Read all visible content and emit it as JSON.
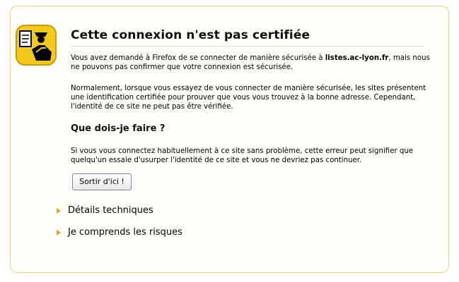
{
  "title": "Cette connexion n'est pas certifiée",
  "para1_prefix": "Vous avez demandé à Firefox de se connecter de manière sécurisée à ",
  "para1_host": "listes.ac-lyon.fr",
  "para1_suffix": ", mais nous ne pouvons pas confirmer que votre connexion est sécurisée.",
  "para2": "Normalement, lorsque vous essayez de vous connecter de manière sécurisée, les sites présentent une identification certifiée pour prouver que vous vous trouvez à la bonne adresse. Cependant, l'identité de ce site ne peut pas être vérifiée.",
  "subtitle": "Que dois-je faire ?",
  "para3": "Si vous vous connectez habituellement à ce site sans problème, cette erreur peut signifier que quelqu'un essaie d'usurper l'identité de ce site et vous ne devriez pas continuer.",
  "button_label": "Sortir d'ici !",
  "expanders": [
    {
      "label": "Détails techniques"
    },
    {
      "label": "Je comprends les risques"
    }
  ],
  "icon": "security-officer-icon",
  "colors": {
    "frame_border": "#f0cf78",
    "arrow": "#e6a11a",
    "icon_bg": "#f3c91a"
  }
}
